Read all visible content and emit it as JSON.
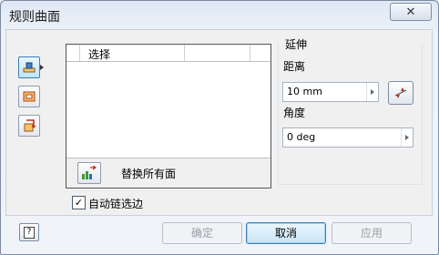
{
  "window": {
    "title": "规则曲面"
  },
  "mode_buttons": [
    {
      "name": "mode-normal-to-surface",
      "active": true
    },
    {
      "name": "mode-tangent-to-surface",
      "active": false
    },
    {
      "name": "mode-sweep",
      "active": false
    }
  ],
  "selection": {
    "header": "选择",
    "replace_all_label": "替换所有面",
    "auto_chain_label": "自动链选边",
    "auto_chain_checked": true,
    "checkmark": "✓"
  },
  "extend": {
    "group_label": "延伸",
    "distance_label": "距离",
    "distance_value": "10 mm",
    "angle_label": "角度",
    "angle_value": "0 deg"
  },
  "buttons": {
    "help": "?",
    "ok": "确定",
    "cancel": "取消",
    "apply": "应用",
    "close": "✕"
  }
}
